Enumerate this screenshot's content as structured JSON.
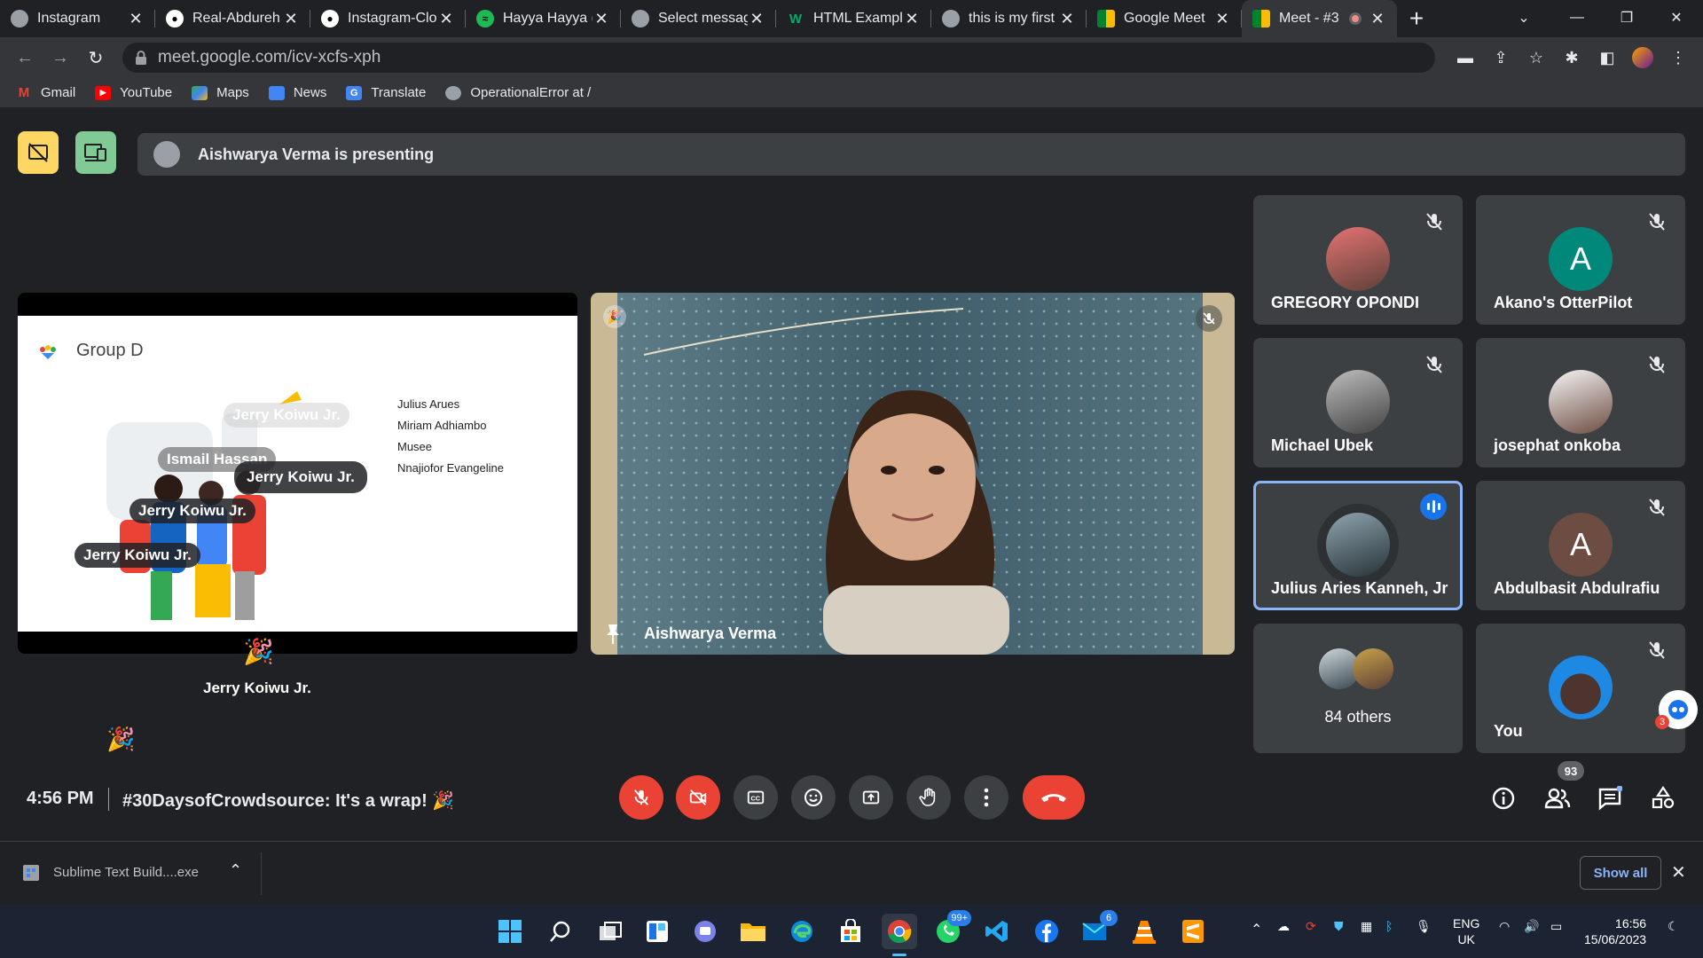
{
  "browser": {
    "tabs": [
      {
        "title": "Instagram",
        "icon": "instagram-globe-icon"
      },
      {
        "title": "Real-Abdureh",
        "icon": "github-icon"
      },
      {
        "title": "Instagram-Clo",
        "icon": "github-icon"
      },
      {
        "title": "Hayya Hayya (",
        "icon": "spotify-icon"
      },
      {
        "title": "Select messag",
        "icon": "globe-icon"
      },
      {
        "title": "HTML Exampl",
        "icon": "w3schools-icon"
      },
      {
        "title": "this is my first",
        "icon": "globe-icon"
      },
      {
        "title": "Google Meet",
        "icon": "google-meet-icon"
      },
      {
        "title": "Meet - #3",
        "icon": "google-meet-icon",
        "active": true,
        "recording": true
      }
    ],
    "url": "meet.google.com/icv-xcfs-xph",
    "bookmarks": [
      "Gmail",
      "YouTube",
      "Maps",
      "News",
      "Translate",
      "OperationalError at /"
    ]
  },
  "meet": {
    "presenting_banner": "Aishwarya Verma is presenting",
    "slide": {
      "title": "Group D",
      "members": [
        "Julius Arues",
        "Miriam Adhiambo",
        "Musee",
        "Nnajiofor Evangeline"
      ],
      "chips": [
        "Jerry Koiwu Jr.",
        "Ismail Hassan",
        "Jerry Koiwu Jr.",
        "Jerry Koiwu Jr.",
        "Jerry Koiwu Jr."
      ]
    },
    "reaction_name": "Jerry Koiwu Jr.",
    "presenter_name": "Aishwarya Verma",
    "participants": [
      {
        "name": "GREGORY OPONDI",
        "avatar": "photo",
        "muted": true
      },
      {
        "name": "Akano's OtterPilot",
        "avatar": "A",
        "color": "#00897b",
        "muted": true
      },
      {
        "name": "Michael Ubek",
        "avatar": "photo",
        "muted": true
      },
      {
        "name": "josephat onkoba",
        "avatar": "photo",
        "muted": true
      },
      {
        "name": "Julius Aries Kanneh, Jr",
        "avatar": "photo",
        "speaking": true
      },
      {
        "name": "Abdulbasit Abdulrafiu",
        "avatar": "A",
        "color": "#6d4c41",
        "muted": true
      },
      {
        "name": "84 others",
        "avatar": "group"
      },
      {
        "name": "You",
        "avatar": "photo",
        "muted": true
      }
    ],
    "time": "4:56 PM",
    "meeting_title": "#30DaysofCrowdsource: It's a wrap! 🎉",
    "people_count": "93",
    "assistant_badge": "3"
  },
  "download": {
    "file": "Sublime Text Build....exe",
    "show_all": "Show all"
  },
  "taskbar": {
    "whatsapp_badge": "99+",
    "mail_badge": "6",
    "lang_top": "ENG",
    "lang_bottom": "UK",
    "clock_time": "16:56",
    "clock_date": "15/06/2023"
  },
  "colors": {
    "accent": "#8ab4f8",
    "danger": "#ea4335",
    "tile": "#3c4043",
    "bg": "#202124"
  }
}
